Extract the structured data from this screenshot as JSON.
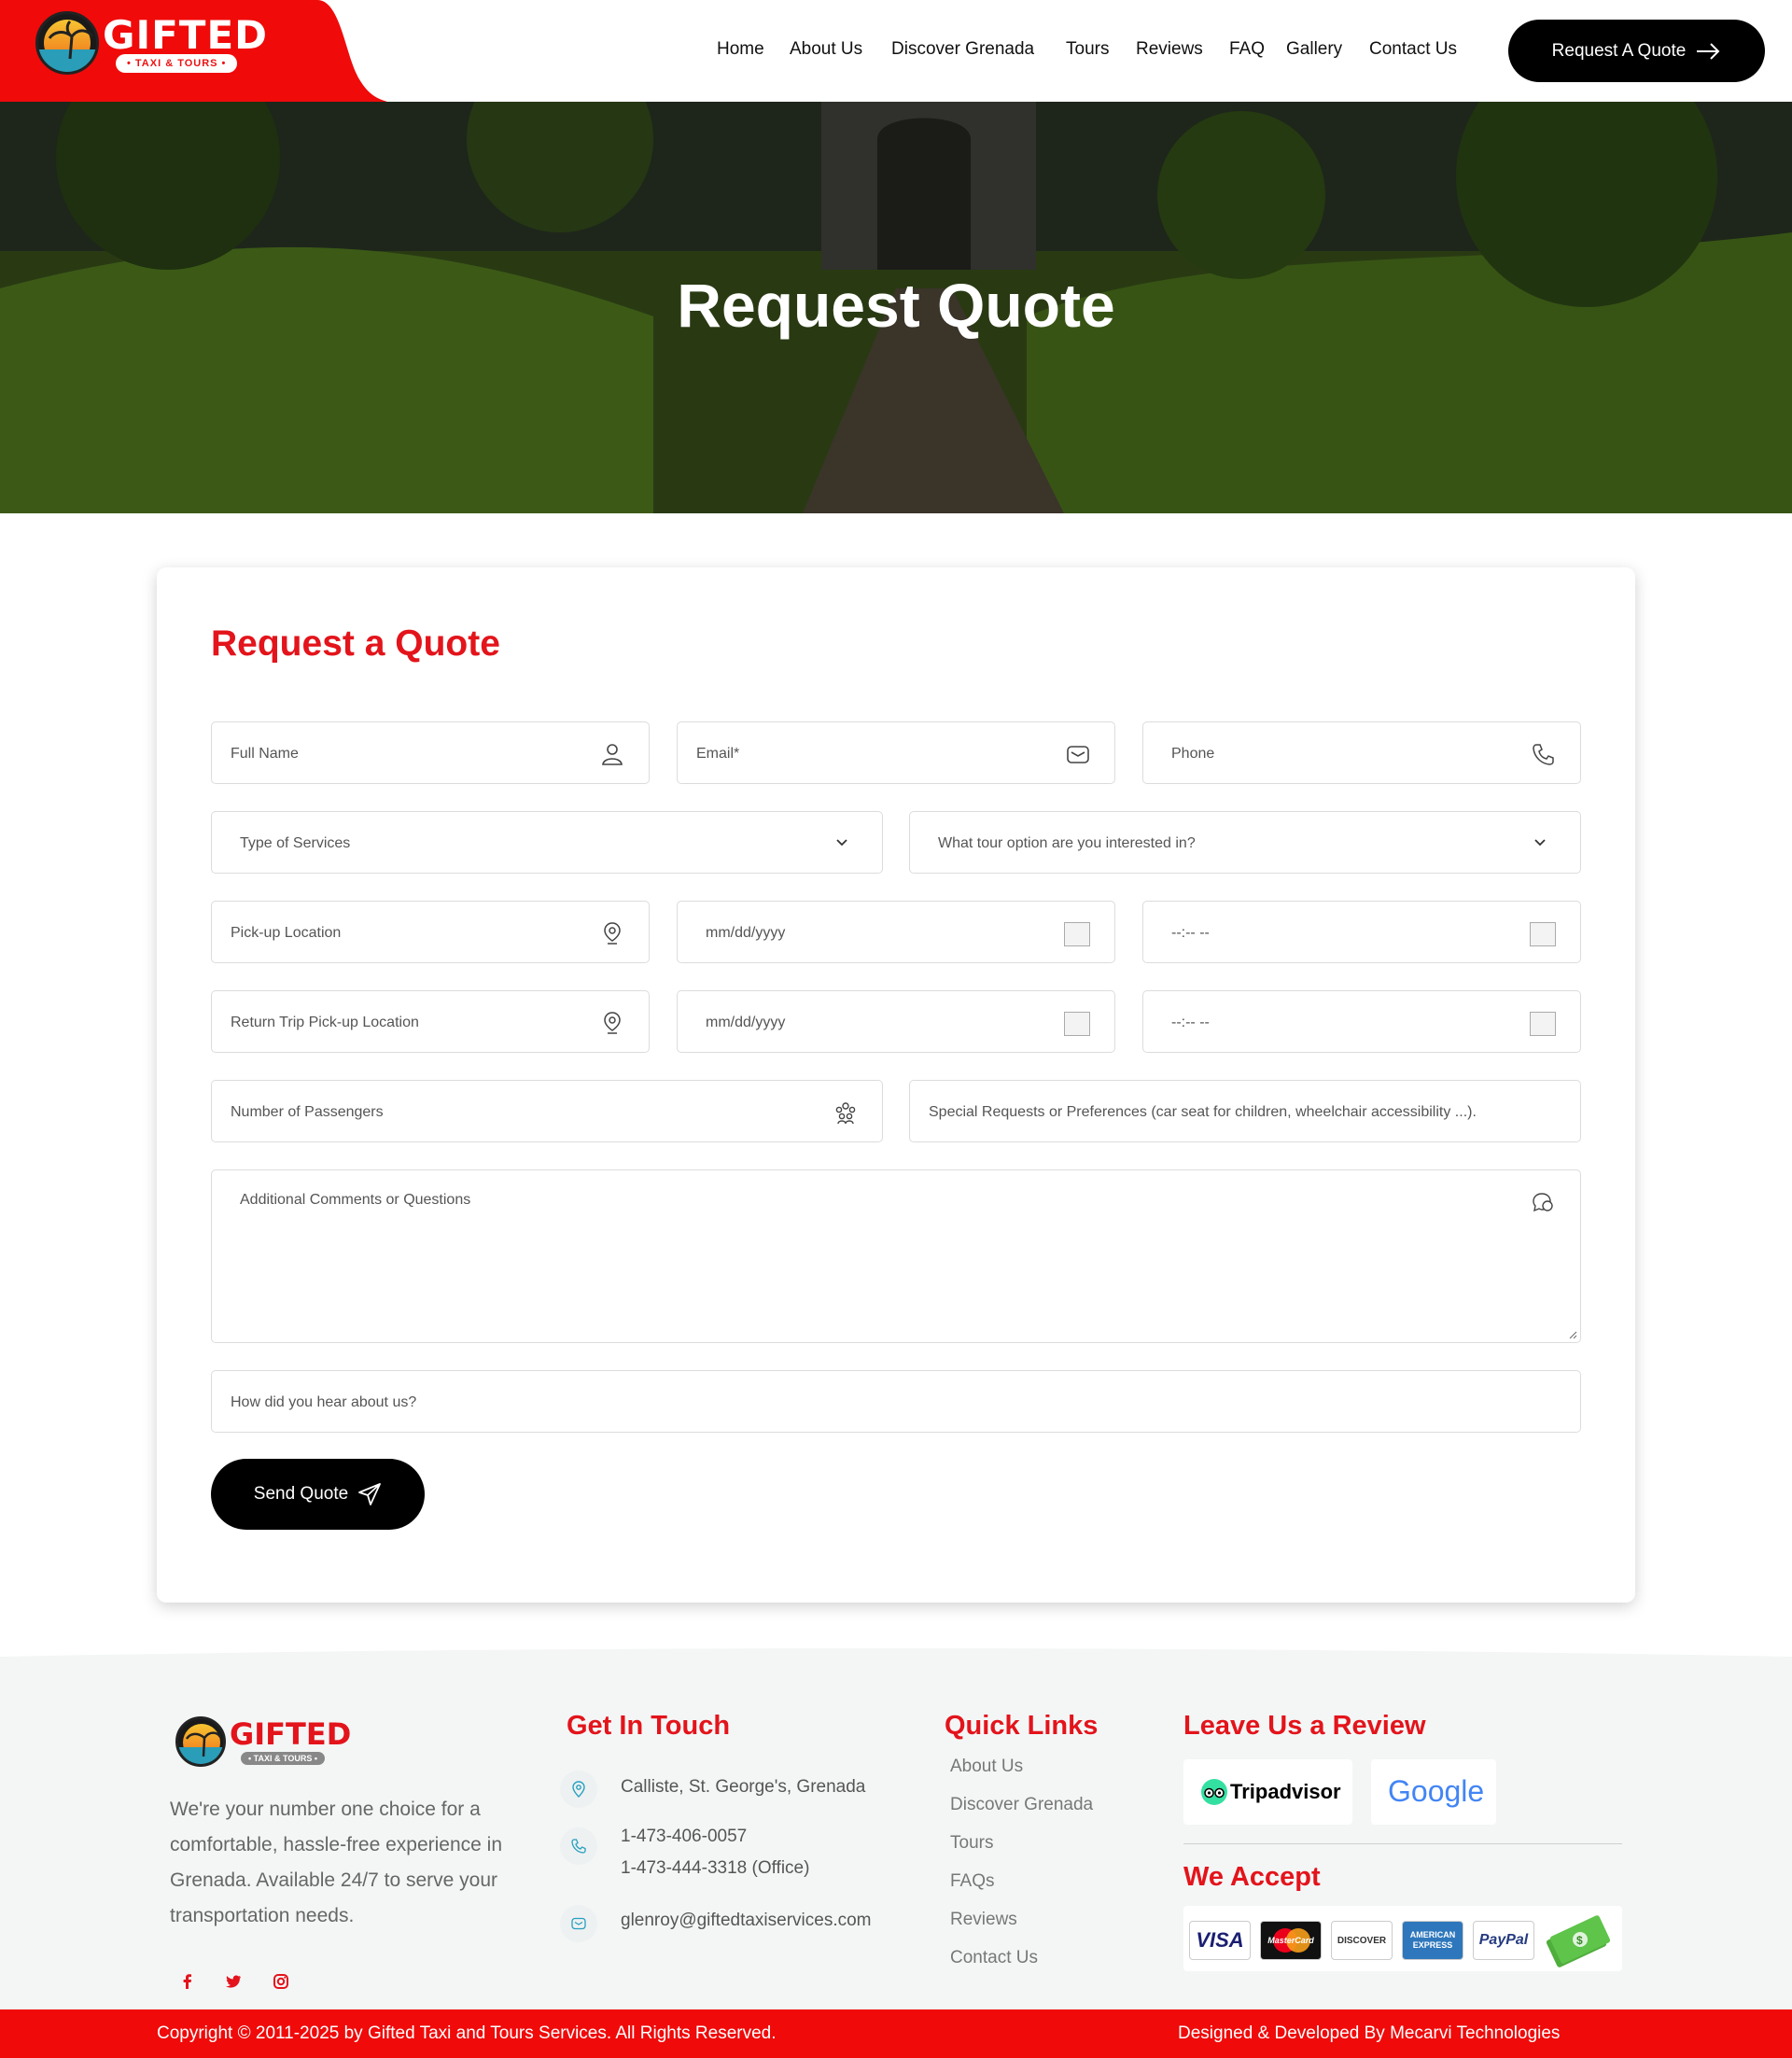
{
  "brand": {
    "name": "GIFTED",
    "tagline": "• TAXI & TOURS •",
    "primary_color": "#e3141b",
    "dark_color": "#000000"
  },
  "nav": {
    "items": [
      "Home",
      "About Us",
      "Discover Grenada",
      "Tours",
      "Reviews",
      "FAQ",
      "Gallery",
      "Contact Us"
    ],
    "cta_label": "Request A Quote"
  },
  "hero": {
    "title": "Request Quote"
  },
  "form": {
    "title": "Request a Quote",
    "full_name": "Full Name",
    "email": "Email*",
    "phone": "Phone",
    "type_of_services": "Type of Services",
    "tour_option": "What tour option are you interested in?",
    "pickup_location": "Pick-up Location",
    "pickup_date": "mm/dd/yyyy",
    "pickup_time": "--:-- --",
    "return_location": "Return Trip Pick-up Location",
    "return_date": "mm/dd/yyyy",
    "return_time": "--:-- --",
    "passengers": "Number of Passengers",
    "special_requests": "Special Requests or Preferences  (car seat for children, wheelchair accessibility ...).",
    "comments": "Additional Comments or Questions",
    "hear_about": "How did you hear about us?",
    "submit_label": "Send Quote"
  },
  "footer": {
    "about": "We're your number one choice for a comfortable, hassle-free experience in Grenada. Available 24/7 to serve your transportation needs.",
    "get_in_touch_title": "Get In Touch",
    "address": "Calliste, St. George's, Grenada",
    "phone_1": "1-473-406-0057",
    "phone_2": "1-473-444-3318 (Office)",
    "email": "glenroy@giftedtaxiservices.com",
    "quick_links_title": "Quick Links",
    "quick_links": [
      "About Us",
      "Discover Grenada",
      "Tours",
      "FAQs",
      "Reviews",
      "Contact Us"
    ],
    "review_title": "Leave Us a Review",
    "tripadvisor": "Tripadvisor",
    "google": "Google",
    "accept_title": "We Accept",
    "payment_cards": [
      "VISA",
      "MasterCard",
      "DISCOVER",
      "AMERICAN EXPRESS",
      "PayPal"
    ],
    "copyright": "Copyright © 2011-2025 by Gifted Taxi and Tours Services. All Rights Reserved.",
    "credit": "Designed & Developed By Mecarvi Technologies"
  }
}
